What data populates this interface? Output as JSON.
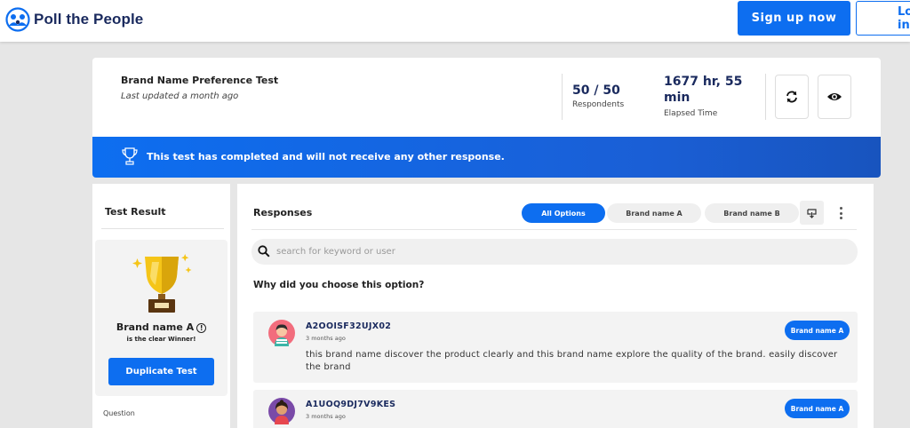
{
  "brand": {
    "name": "Poll the People"
  },
  "topbar": {
    "signup_label": "Sign up now",
    "login_label": "Log in"
  },
  "test": {
    "title": "Brand Name Preference Test",
    "updated": "Last updated a month ago",
    "respondents_value": "50 / 50",
    "respondents_label": "Respondents",
    "elapsed_value_line1": "1677 hr, 55",
    "elapsed_value_line2": "min",
    "elapsed_label": "Elapsed Time",
    "refresh_icon": "refresh-icon",
    "view_icon": "eye-icon"
  },
  "banner": {
    "icon": "trophy-icon",
    "text": "This test has completed and will not receive any other response."
  },
  "result": {
    "title": "Test Result",
    "winner_name": "Brand name A",
    "winner_sub": "is the clear Winner!",
    "duplicate_label": "Duplicate Test",
    "question_label": "Question"
  },
  "responses": {
    "title": "Responses",
    "filters": [
      "All Options",
      "Brand name A",
      "Brand name B"
    ],
    "active_filter": "All Options",
    "search_placeholder": "search for keyword or user",
    "question": "Why did you choose this option?",
    "items": [
      {
        "user": "A2OOISF32UJX02",
        "time": "3 months ago",
        "tag": "Brand name A",
        "text": "this brand name discover the product clearly and this brand name explore the quality of the brand. easily discover the brand"
      },
      {
        "user": "A1UOQ9DJ7V9KES",
        "time": "3 months ago",
        "tag": "Brand name A",
        "text": ""
      }
    ]
  },
  "colors": {
    "accent": "#0d6ef0",
    "navy": "#1a2a5e",
    "background": "#e6e6e6"
  }
}
